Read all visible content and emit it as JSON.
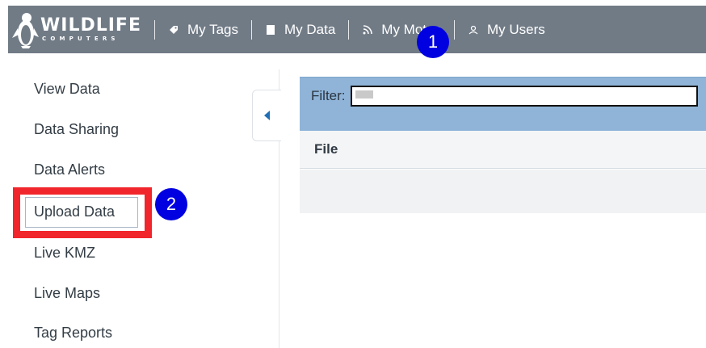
{
  "brand": {
    "name": "WILDLIFE",
    "subtitle": "COMPUTERS"
  },
  "nav": {
    "items": [
      {
        "label": "My Tags",
        "icon": "tag-icon"
      },
      {
        "label": "My Data",
        "icon": "data-icon"
      },
      {
        "label": "My Motes",
        "icon": "rss-icon"
      },
      {
        "label": "My Users",
        "icon": "user-icon"
      }
    ]
  },
  "annotations": {
    "badge_1": "1",
    "badge_2": "2",
    "badge_color": "#0000e0",
    "highlight_color": "#f1262c"
  },
  "sidebar": {
    "items": [
      {
        "label": "View Data"
      },
      {
        "label": "Data Sharing"
      },
      {
        "label": "Data Alerts"
      },
      {
        "label": "Upload Data"
      },
      {
        "label": "Live KMZ"
      },
      {
        "label": "Live Maps"
      },
      {
        "label": "Tag Reports"
      }
    ]
  },
  "main": {
    "filter_label": "Filter:",
    "filter_value": "",
    "columns": [
      "File"
    ]
  },
  "colors": {
    "topbar": "#717b86",
    "filter_bar": "#8fb4d8",
    "accent": "#1f6fb4"
  }
}
